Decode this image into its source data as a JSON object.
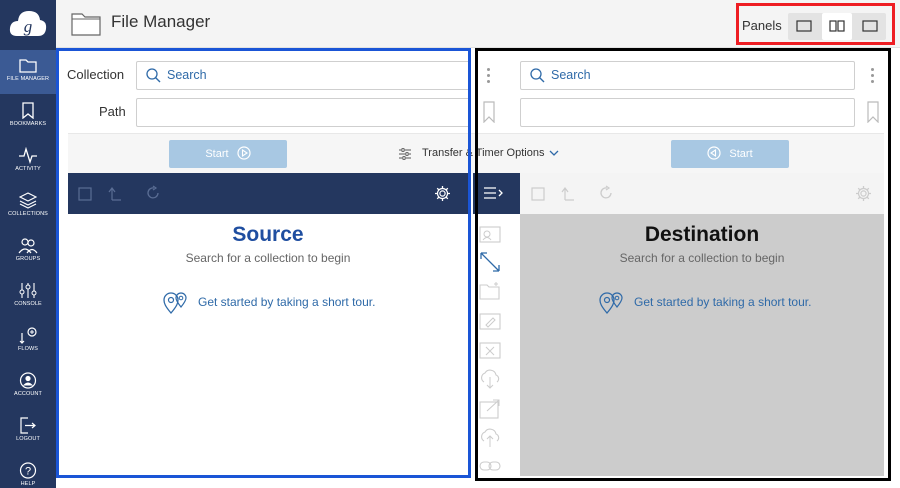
{
  "header": {
    "title": "File Manager",
    "panels_label": "Panels"
  },
  "nav": [
    {
      "id": "file-manager",
      "label": "FILE MANAGER",
      "active": true
    },
    {
      "id": "bookmarks",
      "label": "BOOKMARKS"
    },
    {
      "id": "activity",
      "label": "ACTIVITY"
    },
    {
      "id": "collections",
      "label": "COLLECTIONS"
    },
    {
      "id": "groups",
      "label": "GROUPS"
    },
    {
      "id": "console",
      "label": "CONSOLE"
    },
    {
      "id": "flows",
      "label": "FLOWS"
    },
    {
      "id": "account",
      "label": "ACCOUNT"
    },
    {
      "id": "logout",
      "label": "LOGOUT"
    },
    {
      "id": "help",
      "label": "HELP"
    }
  ],
  "left": {
    "collection_label": "Collection",
    "path_label": "Path",
    "search_placeholder": "Search",
    "start_label": "Start",
    "panel_title": "Source",
    "panel_subtitle": "Search for a collection to begin",
    "tour_text": "Get started by taking a short tour."
  },
  "right": {
    "search_placeholder": "Search",
    "start_label": "Start",
    "panel_title": "Destination",
    "panel_subtitle": "Search for a collection to begin",
    "tour_text": "Get started by taking a short tour."
  },
  "transfer_options": "Transfer & Timer Options",
  "colors": {
    "sidebar": "#24375f",
    "accent": "#2f6aa8",
    "start_disabled": "#a8c8e3"
  }
}
